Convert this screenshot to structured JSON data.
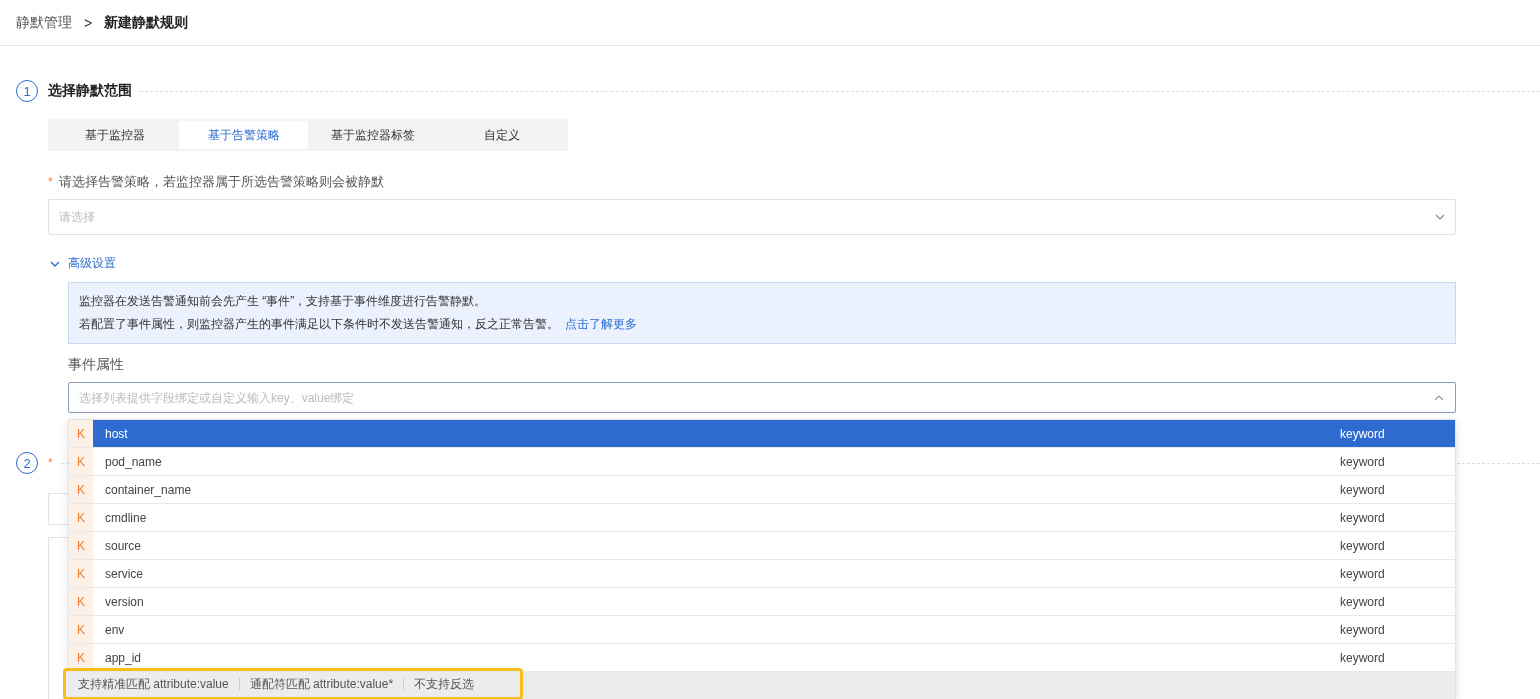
{
  "breadcrumb": {
    "parent": "静默管理",
    "separator": ">",
    "current": "新建静默规则"
  },
  "section_1": {
    "step": "1",
    "title": "选择静默范围",
    "tabs": [
      {
        "label": "基于监控器",
        "selected": false
      },
      {
        "label": "基于告警策略",
        "selected": true
      },
      {
        "label": "基于监控器标签",
        "selected": false
      },
      {
        "label": "自定义",
        "selected": false
      }
    ],
    "required_mark": "*",
    "field_label": "请选择告警策略，若监控器属于所选告警策略则会被静默",
    "select": {
      "placeholder": "请选择"
    },
    "advanced": {
      "label": "高级设置",
      "expanded": true,
      "info": {
        "line_1": "监控器在发送告警通知前会先产生 “事件”，支持基于事件维度进行告警静默。",
        "line_2": "若配置了事件属性，则监控器产生的事件满足以下条件时不发送告警通知，反之正常告警。",
        "link": "点击了解更多"
      },
      "event_label": "事件属性",
      "event_input": {
        "placeholder": "选择列表提供字段绑定或自定义输入key、value绑定"
      },
      "dropdown": {
        "options": [
          {
            "badge": "K",
            "name": "host",
            "type": "keyword",
            "selected": true
          },
          {
            "badge": "K",
            "name": "pod_name",
            "type": "keyword",
            "selected": false
          },
          {
            "badge": "K",
            "name": "container_name",
            "type": "keyword",
            "selected": false
          },
          {
            "badge": "K",
            "name": "cmdline",
            "type": "keyword",
            "selected": false
          },
          {
            "badge": "K",
            "name": "source",
            "type": "keyword",
            "selected": false
          },
          {
            "badge": "K",
            "name": "service",
            "type": "keyword",
            "selected": false
          },
          {
            "badge": "K",
            "name": "version",
            "type": "keyword",
            "selected": false
          },
          {
            "badge": "K",
            "name": "env",
            "type": "keyword",
            "selected": false
          },
          {
            "badge": "K",
            "name": "app_id",
            "type": "keyword",
            "selected": false
          }
        ],
        "hints": [
          "支持精准匹配 attribute:value",
          "通配符匹配 attribute:value*",
          "不支持反选"
        ]
      }
    }
  },
  "section_2": {
    "step": "2",
    "required_mark": "*"
  }
}
